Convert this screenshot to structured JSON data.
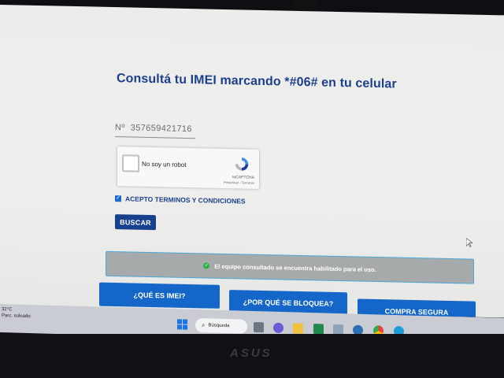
{
  "page": {
    "title": "Consultá tu IMEI marcando *#06# en tu celular"
  },
  "imei_input": {
    "placeholder": "Nº  357659421716"
  },
  "recaptcha": {
    "label": "No soy un robot",
    "brand": "reCAPTCHA",
    "links": "Privacidad - Términos"
  },
  "terms": {
    "label": "ACEPTO TERMINOS Y CONDICIONES",
    "checked": true
  },
  "search_button": {
    "label": "BUSCAR"
  },
  "status": {
    "text": "El equipo consultado se encuentra habilitado para el uso."
  },
  "nav_buttons": [
    {
      "label": "¿QUÉ ES IMEI?"
    },
    {
      "label": "¿POR QUÉ SE BLOQUEA?"
    },
    {
      "label": "COMPRA SEGURA"
    }
  ],
  "taskbar": {
    "weather_temp": "32°C",
    "weather_desc": "Parc. soleado",
    "search_label": "Búsqueda"
  },
  "monitor": {
    "brand": "ASUS"
  },
  "colors": {
    "accent": "#1b3f8c",
    "button_blue": "#1466c8",
    "success": "#2bb34b",
    "banner": "#a7aaab"
  }
}
